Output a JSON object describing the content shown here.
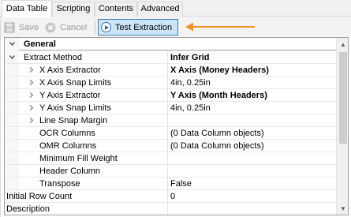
{
  "tabs": [
    {
      "label": "Data Table",
      "active": true
    },
    {
      "label": "Scripting",
      "active": false
    },
    {
      "label": "Contents",
      "active": false
    },
    {
      "label": "Advanced",
      "active": false
    }
  ],
  "toolbar": {
    "save_label": "Save",
    "cancel_label": "Cancel",
    "test_extraction_label": "Test Extraction",
    "save_icon": "save-icon",
    "cancel_icon": "cancel-icon",
    "test_icon": "play-icon",
    "arrow_color": "#f0922e",
    "highlight_color": "#cce4f7"
  },
  "property_grid": {
    "category": "General",
    "rows": [
      {
        "name": "Extract Method",
        "value": "Infer Grid",
        "bold": true,
        "indent": 0,
        "expander": "expanded"
      },
      {
        "name": "X Axis Extractor",
        "value": "X Axis (Money Headers)",
        "bold": true,
        "indent": 1,
        "expander": "collapsed"
      },
      {
        "name": "X Axis Snap Limits",
        "value": "4in, 0.25in",
        "bold": false,
        "indent": 1,
        "expander": "collapsed"
      },
      {
        "name": "Y Axis Extractor",
        "value": "Y Axis (Month Headers)",
        "bold": true,
        "indent": 1,
        "expander": "collapsed"
      },
      {
        "name": "Y Axis Snap Limits",
        "value": "4in, 0.25in",
        "bold": false,
        "indent": 1,
        "expander": "collapsed"
      },
      {
        "name": "Line Snap Margin",
        "value": "",
        "bold": false,
        "indent": 1,
        "expander": "collapsed"
      },
      {
        "name": "OCR Columns",
        "value": "(0 Data Column objects)",
        "bold": false,
        "indent": 2,
        "expander": "none"
      },
      {
        "name": "OMR Columns",
        "value": "(0 Data Column objects)",
        "bold": false,
        "indent": 2,
        "expander": "none"
      },
      {
        "name": "Minimum Fill Weight",
        "value": "",
        "bold": false,
        "indent": 2,
        "expander": "none"
      },
      {
        "name": "Header Column",
        "value": "",
        "bold": false,
        "indent": 2,
        "expander": "none"
      },
      {
        "name": "Transpose",
        "value": "False",
        "bold": false,
        "indent": 2,
        "expander": "none"
      },
      {
        "name": "Initial Row Count",
        "value": "0",
        "bold": false,
        "indent": -1,
        "expander": "none"
      },
      {
        "name": "Description",
        "value": "",
        "bold": false,
        "indent": -1,
        "expander": "none"
      }
    ]
  }
}
